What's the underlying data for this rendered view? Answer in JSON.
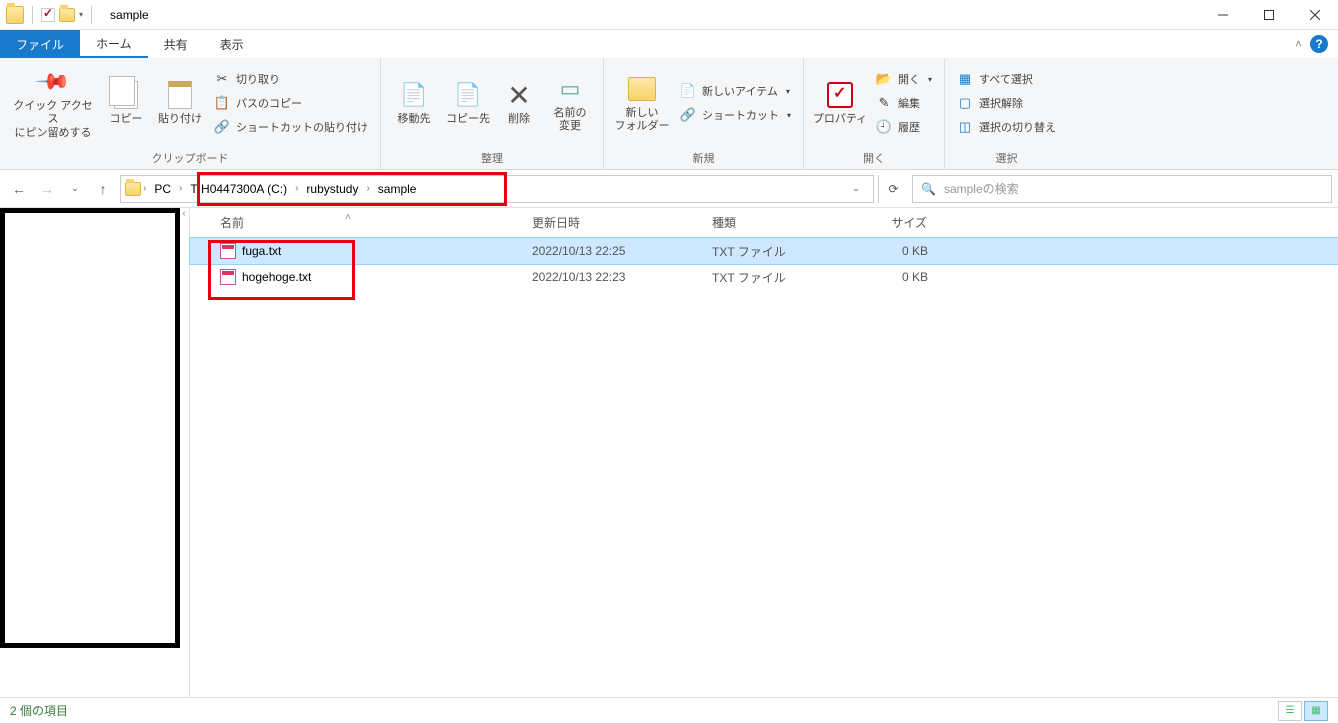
{
  "title": "sample",
  "tabs": {
    "file": "ファイル",
    "home": "ホーム",
    "share": "共有",
    "view": "表示"
  },
  "ribbon": {
    "clipboard": {
      "pin": "クイック アクセス\nにピン留めする",
      "copy": "コピー",
      "paste": "貼り付け",
      "cut": "切り取り",
      "copypath": "パスのコピー",
      "pasteshortcut": "ショートカットの貼り付け",
      "label": "クリップボード"
    },
    "organize": {
      "moveto": "移動先",
      "copyto": "コピー先",
      "delete": "削除",
      "rename": "名前の\n変更",
      "label": "整理"
    },
    "new": {
      "newfolder": "新しい\nフォルダー",
      "newitem": "新しいアイテム",
      "shortcut": "ショートカット",
      "label": "新規"
    },
    "open": {
      "properties": "プロパティ",
      "open": "開く",
      "edit": "編集",
      "history": "履歴",
      "label": "開く"
    },
    "select": {
      "selectall": "すべて選択",
      "selectnone": "選択解除",
      "invert": "選択の切り替え",
      "label": "選択"
    }
  },
  "breadcrumb": {
    "pc": "PC",
    "drive": "TIH0447300A (C:)",
    "folder1": "rubystudy",
    "folder2": "sample"
  },
  "search": {
    "placeholder": "sampleの検索"
  },
  "columns": {
    "name": "名前",
    "date": "更新日時",
    "type": "種類",
    "size": "サイズ"
  },
  "files": [
    {
      "name": "fuga.txt",
      "date": "2022/10/13 22:25",
      "type": "TXT ファイル",
      "size": "0 KB",
      "selected": true
    },
    {
      "name": "hogehoge.txt",
      "date": "2022/10/13 22:23",
      "type": "TXT ファイル",
      "size": "0 KB",
      "selected": false
    }
  ],
  "status": "2 個の項目"
}
